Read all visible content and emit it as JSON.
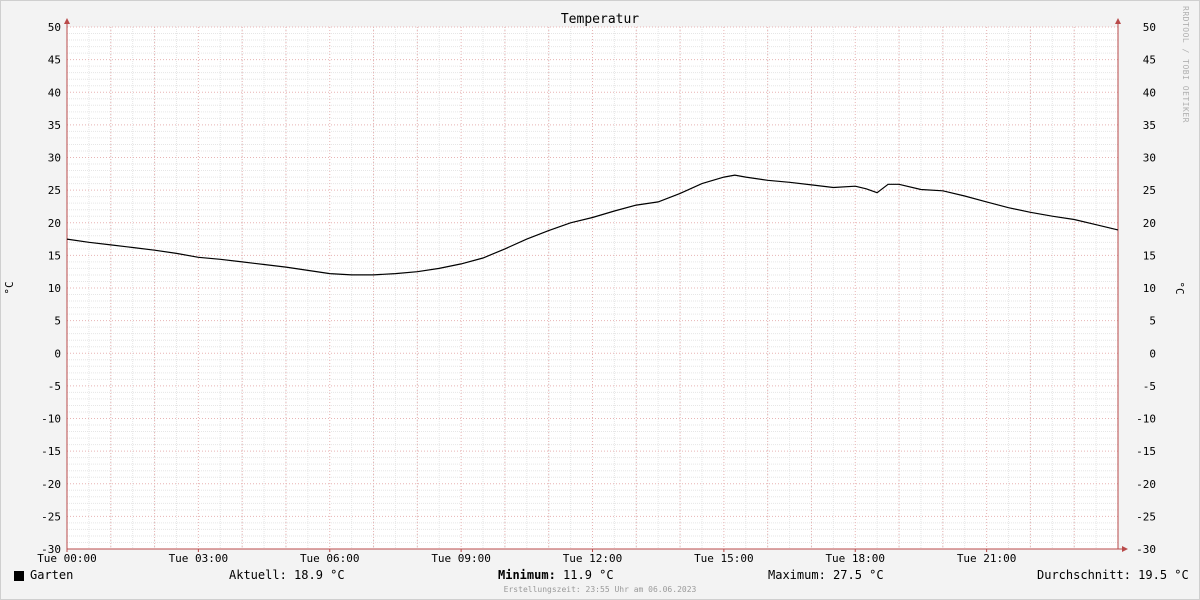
{
  "chart_data": {
    "type": "line",
    "title": "Temperatur",
    "ylabel_left": "°C",
    "ylabel_right": "°C",
    "watermark": "RRDTOOL / TOBI OETIKER",
    "ylim": [
      -30,
      50
    ],
    "y_ticks": [
      "50",
      "45",
      "40",
      "35",
      "30",
      "25",
      "20",
      "15",
      "10",
      "5",
      "0",
      "-5",
      "-10",
      "-15",
      "-20",
      "-25",
      "-30"
    ],
    "x_range_hours": [
      0,
      24
    ],
    "x_ticks": [
      {
        "hour": 0,
        "label": "Tue 00:00"
      },
      {
        "hour": 3,
        "label": "Tue 03:00"
      },
      {
        "hour": 6,
        "label": "Tue 06:00"
      },
      {
        "hour": 9,
        "label": "Tue 09:00"
      },
      {
        "hour": 12,
        "label": "Tue 12:00"
      },
      {
        "hour": 15,
        "label": "Tue 15:00"
      },
      {
        "hour": 18,
        "label": "Tue 18:00"
      },
      {
        "hour": 21,
        "label": "Tue 21:00"
      }
    ],
    "grid": true,
    "series": [
      {
        "name": "Garten",
        "color": "#000000",
        "x": [
          0,
          0.5,
          1,
          1.5,
          2,
          2.5,
          3,
          3.5,
          4,
          4.5,
          5,
          5.5,
          6,
          6.5,
          7,
          7.5,
          8,
          8.5,
          9,
          9.5,
          10,
          10.5,
          11,
          11.5,
          12,
          12.5,
          13,
          13.5,
          14,
          14.5,
          15,
          15.25,
          15.5,
          16,
          16.5,
          17,
          17.5,
          18,
          18.25,
          18.5,
          18.75,
          19,
          19.5,
          20,
          20.5,
          21,
          21.5,
          22,
          22.5,
          23,
          23.5,
          24
        ],
        "y": [
          17.5,
          17.0,
          16.6,
          16.2,
          15.8,
          15.3,
          14.7,
          14.4,
          14.0,
          13.6,
          13.2,
          12.7,
          12.2,
          12.0,
          12.0,
          12.2,
          12.5,
          13.0,
          13.7,
          14.6,
          16.0,
          17.5,
          18.8,
          20.0,
          20.8,
          21.8,
          22.7,
          23.2,
          24.5,
          26.0,
          27.0,
          27.3,
          27.0,
          26.5,
          26.2,
          25.8,
          25.4,
          25.6,
          25.2,
          24.6,
          25.9,
          25.9,
          25.1,
          24.9,
          24.1,
          23.2,
          22.3,
          21.6,
          21.0,
          20.5,
          19.7,
          18.9
        ]
      }
    ]
  },
  "legend": {
    "series_name": "Garten",
    "current": "Aktuell: 18.9 °C",
    "minimum_label": "Minimum:",
    "minimum_value": "11.9 °C",
    "maximum": "Maximum: 27.5 °C",
    "average": "Durchschnitt: 19.5 °C"
  },
  "footer": "Erstellungszeit: 23:55 Uhr am 06.06.2023"
}
